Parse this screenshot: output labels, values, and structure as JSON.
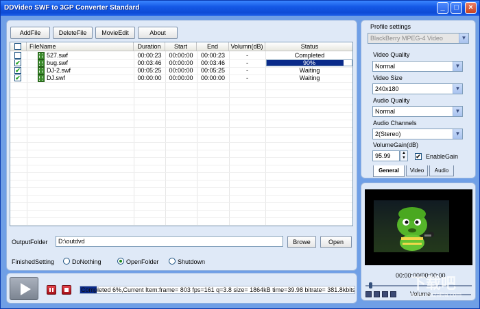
{
  "window": {
    "title": "DDVideo SWF to 3GP Converter Standard",
    "minimize": "_",
    "maximize": "□",
    "close": "×"
  },
  "toolbar": {
    "add_file": "AddFile",
    "delete_file": "DeleteFile",
    "movie_edit": "MovieEdit",
    "about": "About"
  },
  "table": {
    "columns": [
      "FileName",
      "Duration",
      "Start",
      "End",
      "Volumn(dB)",
      "Status"
    ],
    "rows": [
      {
        "checked": false,
        "file": "527.swf",
        "duration": "00:00:23",
        "start": "00:00:00",
        "end": "00:00:23",
        "volume": "-",
        "status": "Completed"
      },
      {
        "checked": true,
        "file": "bug.swf",
        "duration": "00:03:46",
        "start": "00:00:00",
        "end": "00:03:46",
        "volume": "-",
        "status": "90%",
        "progress": 0.9
      },
      {
        "checked": true,
        "file": "DJ-2.swf",
        "duration": "00:05:25",
        "start": "00:00:00",
        "end": "00:05:25",
        "volume": "-",
        "status": "Waiting"
      },
      {
        "checked": true,
        "file": "DJ.swf",
        "duration": "00:00:00",
        "start": "00:00:00",
        "end": "00:00:00",
        "volume": "-",
        "status": "Waiting"
      }
    ]
  },
  "output": {
    "label": "OutputFolder",
    "path": "D:\\outdvd",
    "browse": "Browe",
    "open": "Open"
  },
  "finished": {
    "label": "FinishedSetting",
    "options": [
      {
        "label": "DoNothing",
        "selected": false
      },
      {
        "label": "OpenFolder",
        "selected": true
      },
      {
        "label": "Shutdown",
        "selected": false
      }
    ]
  },
  "profile": {
    "label": "Profile settings",
    "value": "BlackBerry MPEG-4 Video",
    "video_quality_label": "Video Quality",
    "video_quality": "Normal",
    "video_size_label": "Video Size",
    "video_size": "240x180",
    "audio_quality_label": "Audio Quality",
    "audio_quality": "Normal",
    "audio_channels_label": "Audio Channels",
    "audio_channels": "2(Stereo)",
    "volume_gain_label": "VolumeGain(dB)",
    "volume_gain": "95.99",
    "enable_gain_label": "EnableGain",
    "enable_gain": true,
    "tabs": [
      "General",
      "Video",
      "Audio"
    ],
    "active_tab": "General"
  },
  "preview": {
    "time": "00:00:00/00:00:00",
    "volume_label": "Volume",
    "position": 0.03
  },
  "status": {
    "text": "Completed 6%,Current Item:frame=  803 fps=161 q=3.8 size=     1864kB time=39.98 bitrate= 381.8kbits/s",
    "progress": 0.06
  },
  "watermark": {
    "brand": "下载吧",
    "site": "www.xiazaiba.com"
  }
}
